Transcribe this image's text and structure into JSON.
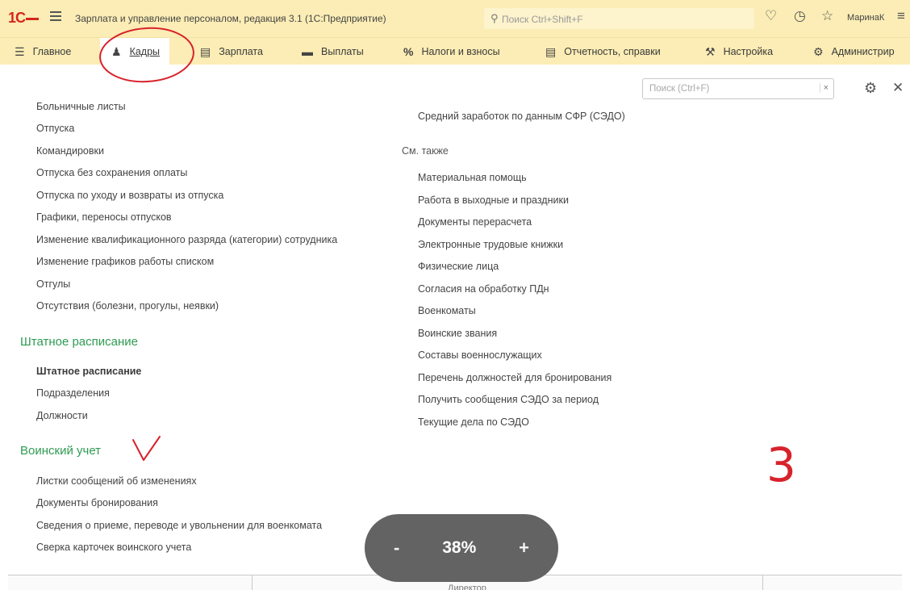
{
  "titlebar": {
    "logo": "1С",
    "title": "Зарплата и управление персоналом, редакция 3.1  (1С:Предприятие)",
    "search_placeholder": "Поиск Ctrl+Shift+F",
    "user": "МаринаК"
  },
  "menu": {
    "items": [
      {
        "label": "Главное",
        "icon": "hamburger-icon"
      },
      {
        "label": "Кадры",
        "icon": "people-icon"
      },
      {
        "label": "Зарплата",
        "icon": "ledger-icon"
      },
      {
        "label": "Выплаты",
        "icon": "cash-icon"
      },
      {
        "label": "Налоги и взносы",
        "icon": "percent-icon"
      },
      {
        "label": "Отчетность, справки",
        "icon": "report-icon"
      },
      {
        "label": "Настройка",
        "icon": "wrench-icon"
      },
      {
        "label": "Администрир",
        "icon": "gear-icon"
      }
    ],
    "active": "Кадры"
  },
  "panel": {
    "search_placeholder": "Поиск (Ctrl+F)",
    "clear_label": "×"
  },
  "left": {
    "links": [
      "Больничные листы",
      "Отпуска",
      "Командировки",
      "Отпуска без сохранения оплаты",
      "Отпуска по уходу и возвраты из отпуска",
      "Графики, переносы отпусков",
      "Изменение квалификационного разряда (категории) сотрудника",
      "Изменение графиков работы списком",
      "Отгулы",
      "Отсутствия (болезни, прогулы, неявки)"
    ],
    "staff_section": "Штатное расписание",
    "staff_links": [
      "Штатное расписание",
      "Подразделения",
      "Должности"
    ],
    "military_section": "Воинский учет",
    "military_links": [
      "Листки сообщений об изменениях",
      "Документы бронирования",
      "Сведения о приеме, переводе и увольнении для военкомата",
      "Сверка карточек воинского учета"
    ]
  },
  "right": {
    "top_link": "Средний заработок по данным СФР (СЭДО)",
    "see_also": "См. также",
    "links": [
      "Материальная помощь",
      "Работа в выходные и праздники",
      "Документы перерасчета",
      "Электронные трудовые книжки",
      "Физические лица",
      "Согласия на обработку ПДн",
      "Военкоматы",
      "Воинские звания",
      "Составы военнослужащих",
      "Перечень должностей для бронирования",
      "Получить сообщения СЭДО за период",
      "Текущие дела по СЭДО"
    ]
  },
  "zoom": {
    "minus": "-",
    "value": "38%",
    "plus": "+"
  },
  "bottom": {
    "text": "Директор"
  },
  "annotations": {
    "mark": "3"
  },
  "colors": {
    "accent": "#fbedb5",
    "section": "#2e9b52",
    "annotation": "#d8222b"
  }
}
